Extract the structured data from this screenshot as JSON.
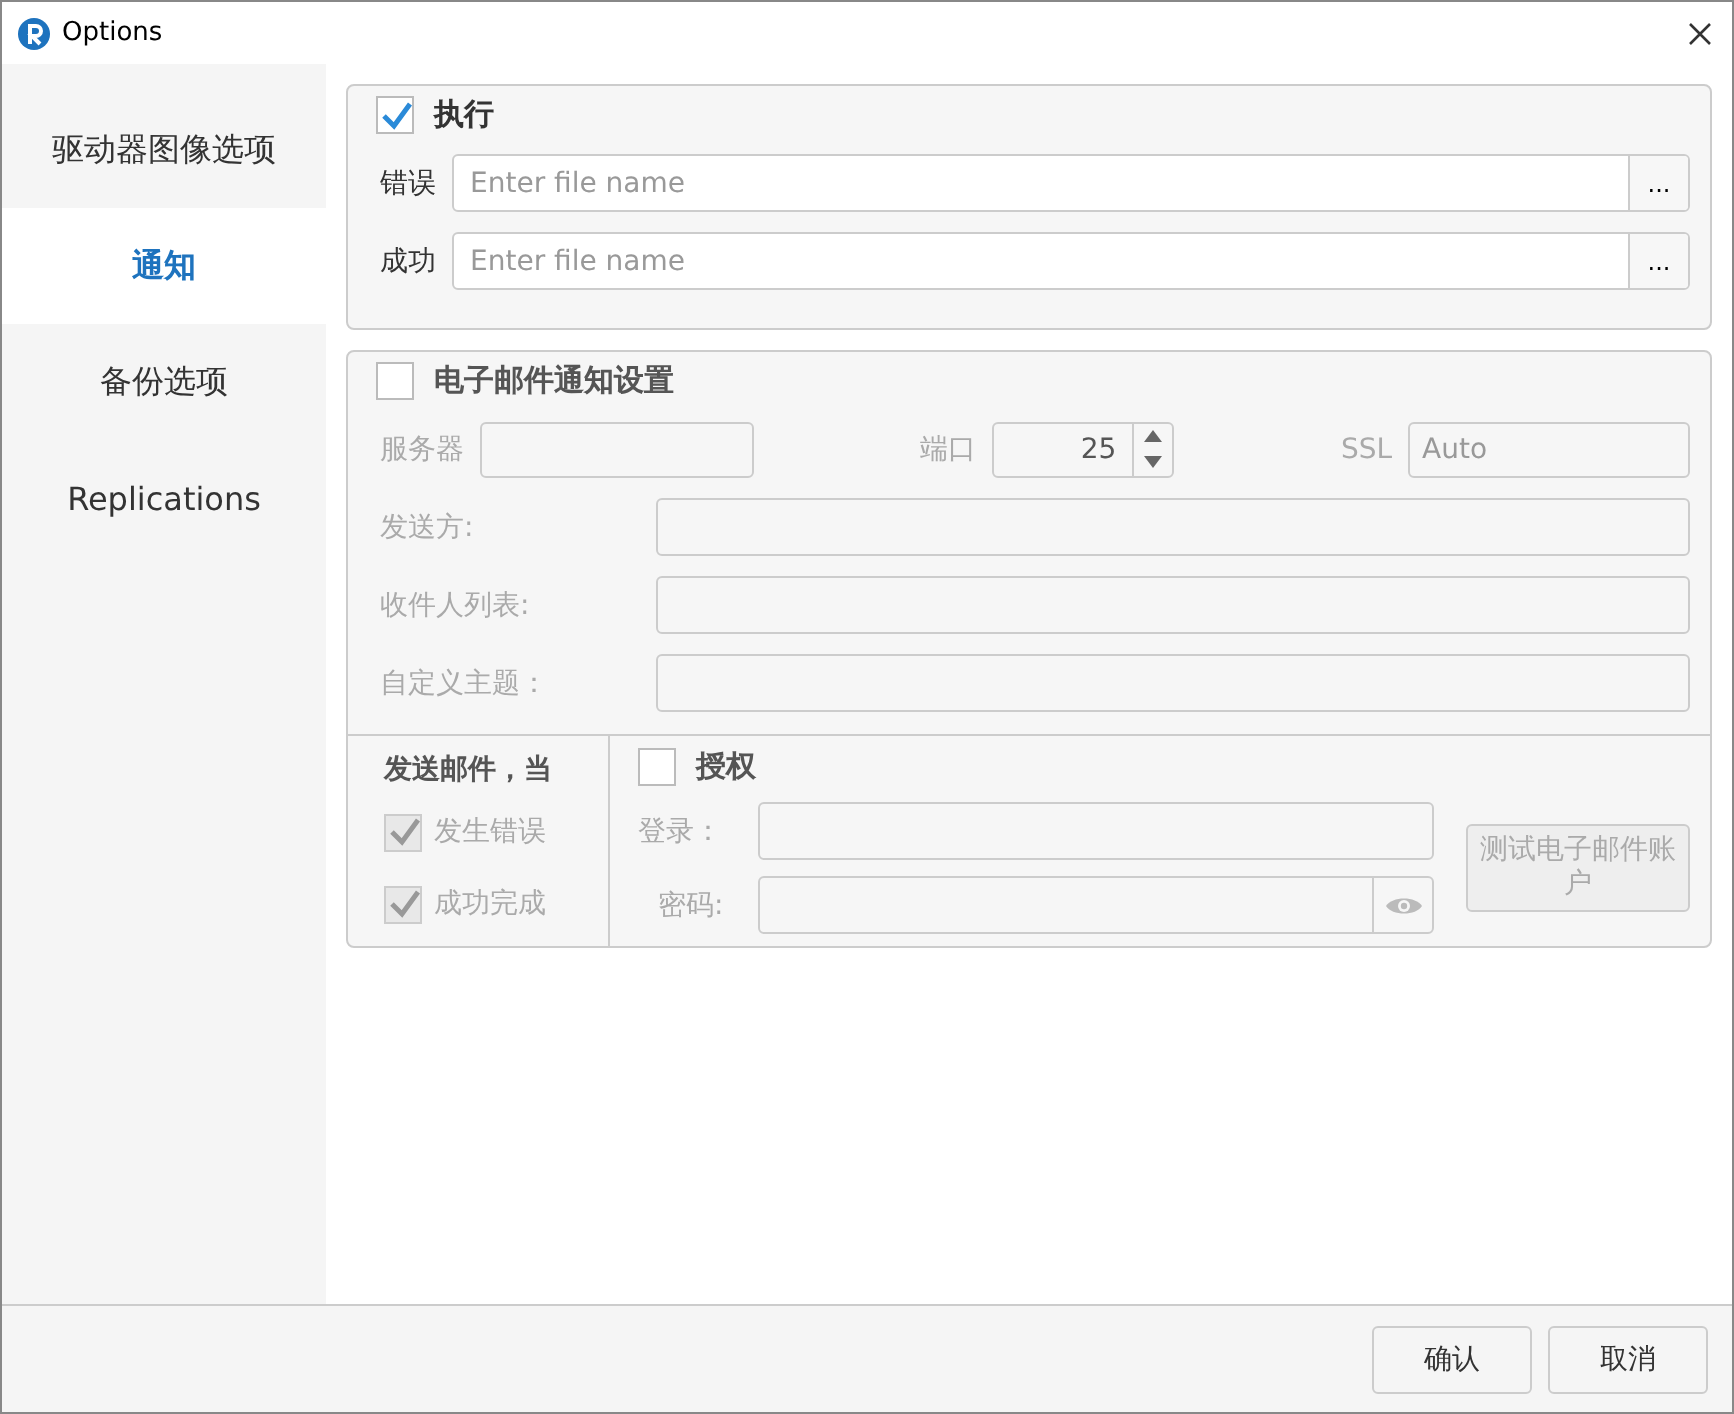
{
  "window": {
    "title": "Options"
  },
  "sidebar": {
    "items": [
      {
        "label": "驱动器图像选项",
        "selected": false
      },
      {
        "label": "通知",
        "selected": true
      },
      {
        "label": "备份选项",
        "selected": false
      },
      {
        "label": "Replications",
        "selected": false
      }
    ]
  },
  "execute": {
    "label": "执行",
    "checked": true,
    "fields": [
      {
        "label": "错误",
        "placeholder": "Enter file name",
        "browse": "..."
      },
      {
        "label": "成功",
        "placeholder": "Enter file name",
        "browse": "..."
      }
    ]
  },
  "email": {
    "label": "电子邮件通知设置",
    "checked": false,
    "server_label": "服务器",
    "port_label": "端口",
    "port": "25",
    "ssl_label": "SSL",
    "ssl": "Auto",
    "rows": [
      {
        "label": "发送方:"
      },
      {
        "label": "收件人列表:"
      },
      {
        "label": "自定义主题："
      }
    ],
    "send_when": {
      "title": "发送邮件，当",
      "options": [
        {
          "label": "发生错误",
          "checked": true
        },
        {
          "label": "成功完成",
          "checked": true
        }
      ]
    },
    "auth": {
      "label": "授权",
      "checked": false,
      "login_label": "登录：",
      "password_label": "密码:",
      "test_button": "测试电子邮件账户"
    }
  },
  "buttons": [
    "确认",
    "取消"
  ]
}
